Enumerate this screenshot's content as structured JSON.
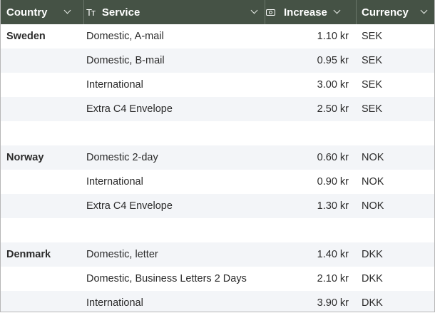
{
  "header": {
    "country": "Country",
    "service": "Service",
    "service_icon": "text-type-icon",
    "increase": "Increase",
    "increase_icon": "money-icon",
    "currency": "Currency"
  },
  "colors": {
    "header_bg": "#455245",
    "header_text": "#ffffff",
    "alt_row": "#f3f5f8"
  },
  "rows": [
    {
      "country": "Sweden",
      "service": "Domestic, A-mail",
      "increase": "1.10 kr",
      "currency": "SEK"
    },
    {
      "country": "",
      "service": "Domestic, B-mail",
      "increase": "0.95 kr",
      "currency": "SEK"
    },
    {
      "country": "",
      "service": "International",
      "increase": "3.00 kr",
      "currency": "SEK"
    },
    {
      "country": "",
      "service": "Extra C4 Envelope",
      "increase": "2.50 kr",
      "currency": "SEK"
    },
    {
      "country": "",
      "service": "",
      "increase": "",
      "currency": ""
    },
    {
      "country": "Norway",
      "service": "Domestic 2-day",
      "increase": "0.60 kr",
      "currency": "NOK"
    },
    {
      "country": "",
      "service": "International",
      "increase": "0.90 kr",
      "currency": "NOK"
    },
    {
      "country": "",
      "service": "Extra C4 Envelope",
      "increase": "1.30 kr",
      "currency": "NOK"
    },
    {
      "country": "",
      "service": "",
      "increase": "",
      "currency": ""
    },
    {
      "country": "Denmark",
      "service": "Domestic, letter",
      "increase": "1.40 kr",
      "currency": "DKK"
    },
    {
      "country": "",
      "service": "Domestic, Business Letters 2 Days",
      "increase": "2.10 kr",
      "currency": "DKK"
    },
    {
      "country": "",
      "service": "International",
      "increase": "3.90 kr",
      "currency": "DKK"
    }
  ]
}
